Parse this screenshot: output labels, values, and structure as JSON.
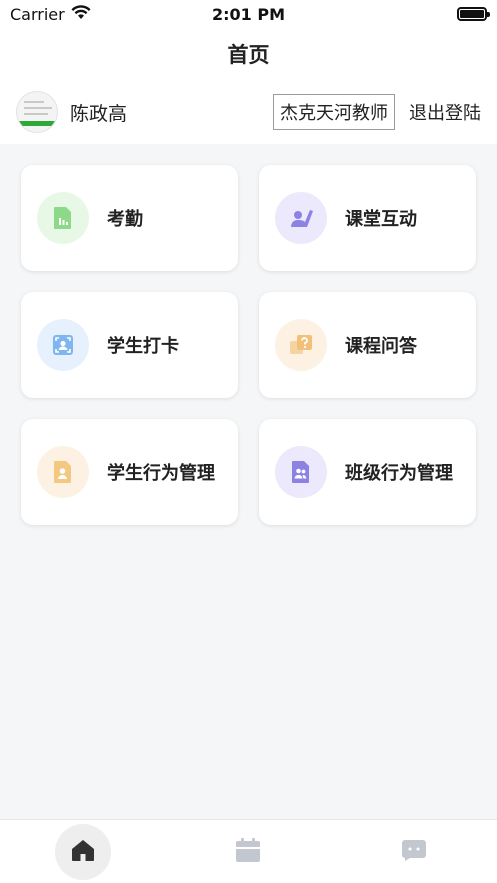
{
  "status_bar": {
    "carrier": "Carrier",
    "time": "2:01 PM"
  },
  "nav": {
    "title": "首页"
  },
  "user": {
    "name": "陈政高",
    "school": "杰克天河教师",
    "logout_label": "退出登陆"
  },
  "menu": [
    {
      "label": "考勤",
      "icon": "attendance-icon",
      "bg": "#e7f8e6",
      "fg": "#8ed88a"
    },
    {
      "label": "课堂互动",
      "icon": "classroom-interaction-icon",
      "bg": "#ebe9fb",
      "fg": "#8c82e3"
    },
    {
      "label": "学生打卡",
      "icon": "student-checkin-icon",
      "bg": "#e6f1fd",
      "fg": "#7fb6ef"
    },
    {
      "label": "课程问答",
      "icon": "course-qa-icon",
      "bg": "#fdf1e3",
      "fg": "#f3c07a"
    },
    {
      "label": "学生行为管理",
      "icon": "student-behavior-icon",
      "bg": "#fdf1e3",
      "fg": "#f3c880"
    },
    {
      "label": "班级行为管理",
      "icon": "class-behavior-icon",
      "bg": "#ebe9fb",
      "fg": "#8c82e3"
    }
  ],
  "tabs": [
    {
      "icon": "home-icon",
      "active": true
    },
    {
      "icon": "calendar-icon",
      "active": false
    },
    {
      "icon": "message-icon",
      "active": false
    }
  ]
}
